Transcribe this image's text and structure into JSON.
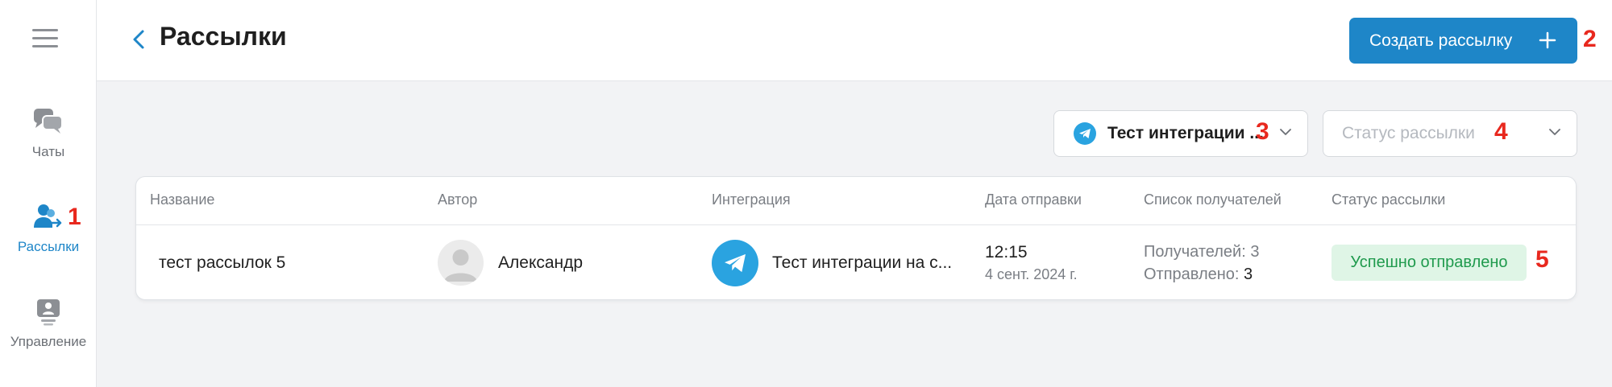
{
  "sidebar": {
    "items": [
      {
        "label": "Чаты",
        "icon": "chats-icon"
      },
      {
        "label": "Рассылки",
        "icon": "mailings-icon",
        "active": true
      },
      {
        "label": "Управление",
        "icon": "management-icon"
      }
    ]
  },
  "header": {
    "title": "Рассылки",
    "create_button_label": "Создать рассылку"
  },
  "filters": {
    "integration_selected": "Тест интеграции ...",
    "status_placeholder": "Статус рассылки"
  },
  "table": {
    "columns": [
      "Название",
      "Автор",
      "Интеграция",
      "Дата отправки",
      "Список получателей",
      "Статус рассылки"
    ],
    "rows": [
      {
        "name": "тест рассылок 5",
        "author": "Александр",
        "integration": "Тест интеграции на с...",
        "time": "12:15",
        "date": "4 сент. 2024 г.",
        "recipients_label": "Получателей:",
        "recipients_value": "3",
        "sent_label": "Отправлено:",
        "sent_value": "3",
        "status": "Успешно отправлено"
      }
    ]
  },
  "annotations": [
    "1",
    "2",
    "3",
    "4",
    "5"
  ],
  "colors": {
    "accent": "#1e86c8",
    "annotation": "#e8281e",
    "telegram": "#2aa3e0",
    "success_bg": "#dff5e6",
    "success_text": "#1f9a4d"
  }
}
